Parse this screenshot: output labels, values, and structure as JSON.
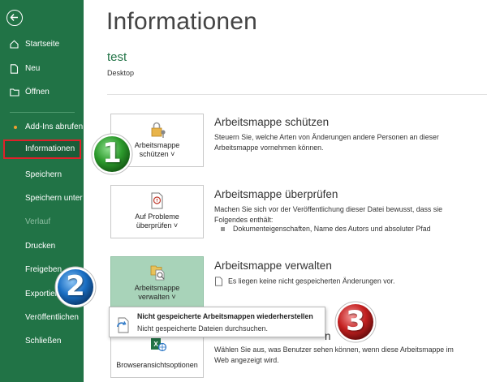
{
  "sidebar": {
    "items": [
      {
        "label": "Startseite"
      },
      {
        "label": "Neu"
      },
      {
        "label": "Öffnen"
      },
      {
        "label": "Add-Ins abrufen"
      },
      {
        "label": "Informationen"
      },
      {
        "label": "Speichern"
      },
      {
        "label": "Speichern unter"
      },
      {
        "label": "Verlauf"
      },
      {
        "label": "Drucken"
      },
      {
        "label": "Freigeben"
      },
      {
        "label": "Exportieren"
      },
      {
        "label": "Veröffentlichen"
      },
      {
        "label": "Schließen"
      }
    ]
  },
  "main": {
    "title": "Informationen",
    "file_name": "test",
    "file_location": "Desktop",
    "protect": {
      "button_line1": "Arbeitsmappe",
      "button_line2": "schützen ˅",
      "title": "Arbeitsmappe schützen",
      "description": "Steuern Sie, welche Arten von Änderungen andere Personen an dieser Arbeitsmappe vornehmen können."
    },
    "inspect": {
      "button_line1": "Auf Probleme",
      "button_line2": "überprüfen ˅",
      "title": "Arbeitsmappe überprüfen",
      "description": "Machen Sie sich vor der Veröffentlichung dieser Datei bewusst, dass sie Folgendes enthält:",
      "bullet": "Dokumenteigenschaften, Name des Autors und absoluter Pfad"
    },
    "manage": {
      "button_line1": "Arbeitsmappe",
      "button_line2": "verwalten ˅",
      "title": "Arbeitsmappe verwalten",
      "note": "Es liegen keine nicht gespeicherten Änderungen vor."
    },
    "popup": {
      "title": "Nicht gespeicherte Arbeitsmappen wiederherstellen",
      "description": "Nicht gespeicherte Dateien durchsuchen."
    },
    "browser": {
      "button_label": "Browseransichtsoptionen",
      "title_partial": "n",
      "description": "Wählen Sie aus, was Benutzer sehen können, wenn diese Arbeitsmappe im Web angezeigt wird."
    }
  },
  "badges": [
    {
      "number": "1",
      "color": "#2c9a2c"
    },
    {
      "number": "2",
      "color": "#1a6fc4"
    },
    {
      "number": "3",
      "color": "#c42020"
    }
  ],
  "colors": {
    "accent": "#217346",
    "active_border": "#e0202a"
  }
}
